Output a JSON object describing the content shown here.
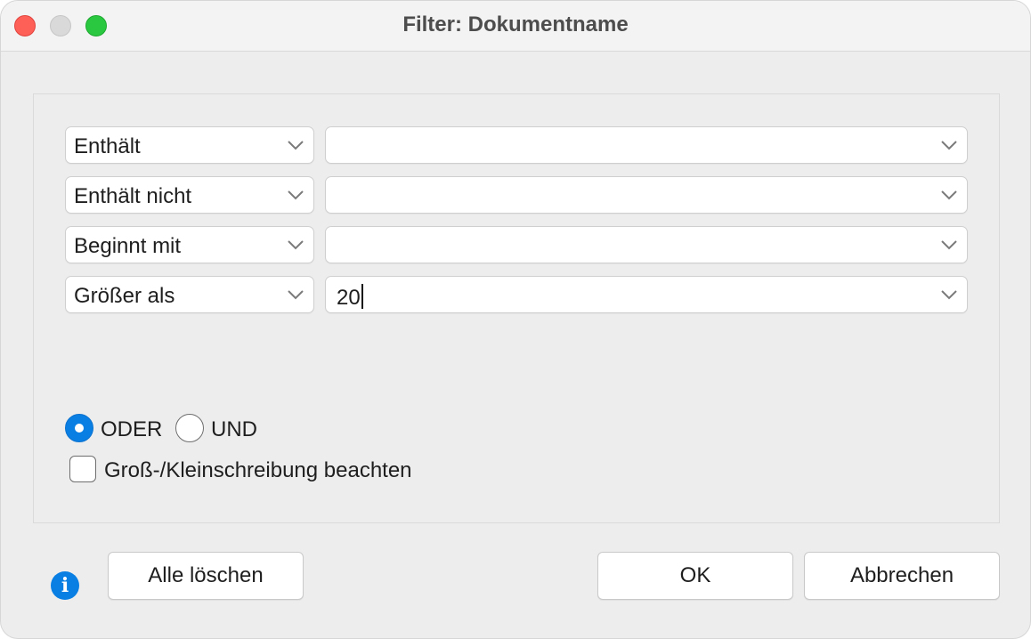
{
  "window": {
    "title": "Filter: Dokumentname"
  },
  "rows": [
    {
      "operator": "Enthält",
      "value": ""
    },
    {
      "operator": "Enthält nicht",
      "value": ""
    },
    {
      "operator": "Beginnt mit",
      "value": ""
    },
    {
      "operator": "Größer als",
      "value": "20"
    }
  ],
  "logic": {
    "options": [
      "ODER",
      "UND"
    ],
    "selected": "ODER"
  },
  "case_sensitive": {
    "label": "Groß-/Kleinschreibung beachten",
    "checked": false
  },
  "buttons": {
    "clear_all": "Alle löschen",
    "ok": "OK",
    "cancel": "Abbrechen"
  },
  "icons": {
    "info": "info-icon",
    "info_glyph": "i",
    "chevron": "chevron-down-icon"
  },
  "colors": {
    "accent": "#0a7fe3",
    "close": "#fe5f57",
    "minimize": "#d9d9d9",
    "zoom": "#2ac840"
  }
}
